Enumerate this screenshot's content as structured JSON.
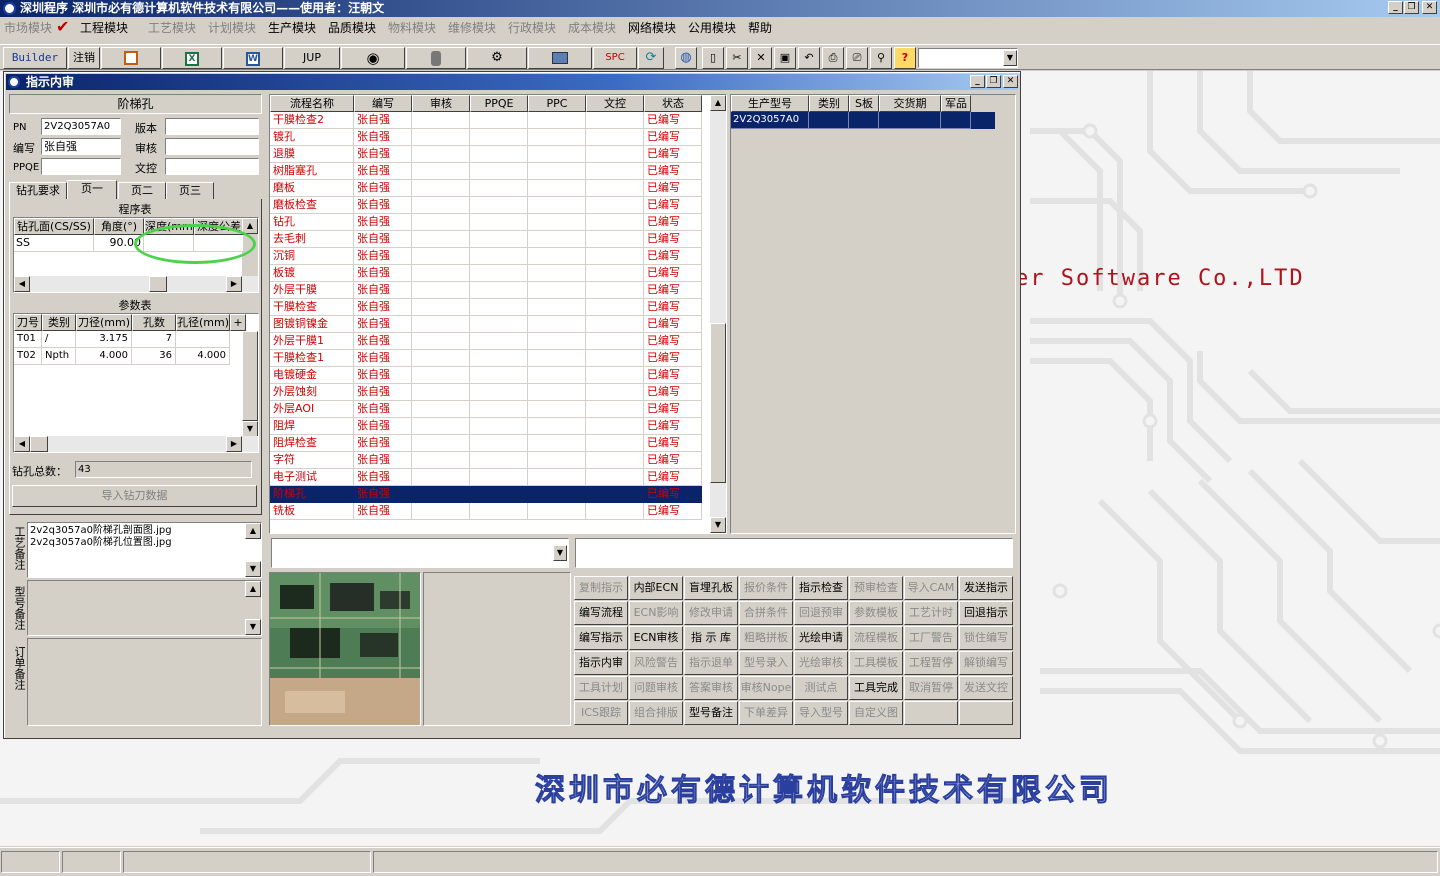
{
  "app": {
    "title": "深圳程序   深圳市必有德计算机软件技术有限公司——使用者：汪朝文"
  },
  "menu": [
    {
      "label": "市场模块",
      "enabled": false
    },
    {
      "label": "工程模块",
      "enabled": true,
      "checked": true
    },
    {
      "label": "工艺模块",
      "enabled": false
    },
    {
      "label": "计划模块",
      "enabled": false
    },
    {
      "label": "生产模块",
      "enabled": true
    },
    {
      "label": "品质模块",
      "enabled": true
    },
    {
      "label": "物料模块",
      "enabled": false
    },
    {
      "label": "维修模块",
      "enabled": false
    },
    {
      "label": "行政模块",
      "enabled": false
    },
    {
      "label": "成本模块",
      "enabled": false
    },
    {
      "label": "网络模块",
      "enabled": true
    },
    {
      "label": "公用模块",
      "enabled": true
    },
    {
      "label": "帮助",
      "enabled": true
    }
  ],
  "toolbar": {
    "builder": "Builder",
    "logout": "注销",
    "jup": "JUP",
    "spc": "SPC",
    "help_icon": "?"
  },
  "window": {
    "title": "指示内审"
  },
  "left": {
    "section_title": "阶梯孔",
    "pn_label": "PN",
    "pn_value": "2V2Q3057A0",
    "version_label": "版本",
    "version_value": "",
    "author_label": "编写",
    "author_value": "张自强",
    "review_label": "审核",
    "review_value": "",
    "ppqe_label": "PPQE",
    "ppqe_value": "",
    "doc_label": "文控",
    "doc_value": "",
    "tabs": [
      "钻孔要求",
      "页一",
      "页二",
      "页三"
    ],
    "program_title": "程序表",
    "program_headers": [
      "钻孔面(CS/SS)",
      "角度(°)",
      "深度(mm)",
      "深度公差"
    ],
    "program_rows": [
      [
        "SS",
        "90.00",
        "",
        ""
      ]
    ],
    "param_title": "参数表",
    "param_headers": [
      "刀号",
      "类别",
      "刀径(mm)",
      "孔数",
      "孔径(mm)",
      "+"
    ],
    "param_rows": [
      [
        "T01",
        "/",
        "3.175",
        "7",
        ""
      ],
      [
        "T02",
        "Npth",
        "4.000",
        "36",
        "4.000"
      ]
    ],
    "drill_total_label": "钻孔总数：",
    "drill_total_value": "43",
    "import_button": "导入钻刀数据",
    "process_note_label": "工艺备注",
    "process_note_lines": [
      "2v2q3057a0阶梯孔剖面图.jpg",
      "2v2q3057a0阶梯孔位置图.jpg"
    ],
    "model_note_label": "型号备注",
    "order_note_label": "订单备注"
  },
  "flow": {
    "headers": [
      "流程名称",
      "编写",
      "审核",
      "PPQE",
      "PPC",
      "文控",
      "状态"
    ],
    "rows": [
      [
        "干膜检查2",
        "张自强",
        "已编写"
      ],
      [
        "镀孔",
        "张自强",
        "已编写"
      ],
      [
        "退膜",
        "张自强",
        "已编写"
      ],
      [
        "树脂塞孔",
        "张自强",
        "已编写"
      ],
      [
        "磨板",
        "张自强",
        "已编写"
      ],
      [
        "磨板检查",
        "张自强",
        "已编写"
      ],
      [
        "钻孔",
        "张自强",
        "已编写"
      ],
      [
        "去毛刺",
        "张自强",
        "已编写"
      ],
      [
        "沉铜",
        "张自强",
        "已编写"
      ],
      [
        "板镀",
        "张自强",
        "已编写"
      ],
      [
        "外层干膜",
        "张自强",
        "已编写"
      ],
      [
        "干膜检查",
        "张自强",
        "已编写"
      ],
      [
        "图镀铜镍金",
        "张自强",
        "已编写"
      ],
      [
        "外层干膜1",
        "张自强",
        "已编写"
      ],
      [
        "干膜检查1",
        "张自强",
        "已编写"
      ],
      [
        "电镀硬金",
        "张自强",
        "已编写"
      ],
      [
        "外层蚀刻",
        "张自强",
        "已编写"
      ],
      [
        "外层AOI",
        "张自强",
        "已编写"
      ],
      [
        "阻焊",
        "张自强",
        "已编写"
      ],
      [
        "阻焊检查",
        "张自强",
        "已编写"
      ],
      [
        "字符",
        "张自强",
        "已编写"
      ],
      [
        "电子测试",
        "张自强",
        "已编写"
      ],
      [
        "阶梯孔",
        "张自强",
        "已编写"
      ],
      [
        "铣板",
        "张自强",
        "已编写"
      ]
    ],
    "selected_index": 22
  },
  "product": {
    "headers": [
      "生产型号",
      "类别",
      "S板",
      "交货期",
      "军品"
    ],
    "rows": [
      [
        "2V2Q3057A0",
        "",
        "",
        "",
        ""
      ]
    ]
  },
  "buttons": [
    [
      {
        "label": "复制指示",
        "enabled": false
      },
      {
        "label": "内部ECN",
        "enabled": true
      },
      {
        "label": "盲埋孔板",
        "enabled": true
      },
      {
        "label": "报价条件",
        "enabled": false
      },
      {
        "label": "指示检查",
        "enabled": true
      },
      {
        "label": "预审检查",
        "enabled": false
      },
      {
        "label": "导入CAM",
        "enabled": false
      },
      {
        "label": "发送指示",
        "enabled": true
      }
    ],
    [
      {
        "label": "编写流程",
        "enabled": true
      },
      {
        "label": "ECN影响",
        "enabled": false
      },
      {
        "label": "修改申请",
        "enabled": false
      },
      {
        "label": "合拼条件",
        "enabled": false
      },
      {
        "label": "回退预审",
        "enabled": false
      },
      {
        "label": "参数模板",
        "enabled": false
      },
      {
        "label": "工艺计时",
        "enabled": false
      },
      {
        "label": "回退指示",
        "enabled": true
      }
    ],
    [
      {
        "label": "编写指示",
        "enabled": true
      },
      {
        "label": "ECN审核",
        "enabled": true
      },
      {
        "label": "指 示 库",
        "enabled": true
      },
      {
        "label": "粗略拼板",
        "enabled": false
      },
      {
        "label": "光绘申请",
        "enabled": true
      },
      {
        "label": "流程模板",
        "enabled": false
      },
      {
        "label": "工厂警告",
        "enabled": false
      },
      {
        "label": "锁住编写",
        "enabled": false
      }
    ],
    [
      {
        "label": "指示内审",
        "enabled": true
      },
      {
        "label": "风险警告",
        "enabled": false
      },
      {
        "label": "指示退单",
        "enabled": false
      },
      {
        "label": "型号录入",
        "enabled": false
      },
      {
        "label": "光绘审核",
        "enabled": false
      },
      {
        "label": "工具模板",
        "enabled": false
      },
      {
        "label": "工程暂停",
        "enabled": false
      },
      {
        "label": "解锁编写",
        "enabled": false
      }
    ],
    [
      {
        "label": "工具计划",
        "enabled": false
      },
      {
        "label": "问题审核",
        "enabled": false
      },
      {
        "label": "答案审核",
        "enabled": false
      },
      {
        "label": "审核Nope",
        "enabled": false
      },
      {
        "label": "测试点",
        "enabled": false
      },
      {
        "label": "工具完成",
        "enabled": true
      },
      {
        "label": "取消暂停",
        "enabled": false
      },
      {
        "label": "发送文控",
        "enabled": false
      }
    ],
    [
      {
        "label": "ICS跟踪",
        "enabled": false
      },
      {
        "label": "组合排版",
        "enabled": false
      },
      {
        "label": "型号备注",
        "enabled": true
      },
      {
        "label": "下单差异",
        "enabled": false
      },
      {
        "label": "导入型号",
        "enabled": false
      },
      {
        "label": "自定义图",
        "enabled": false
      },
      {
        "label": "",
        "enabled": false
      },
      {
        "label": "",
        "enabled": false
      }
    ]
  ],
  "background": {
    "brand_text": "er Software Co.,LTD",
    "company_name": "深圳市必有德计算机软件技术有限公司"
  }
}
